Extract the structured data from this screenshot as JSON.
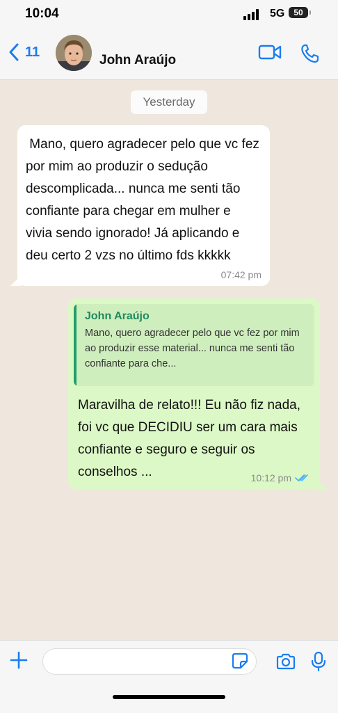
{
  "status_bar": {
    "time": "10:04",
    "network": "5G",
    "battery": "50"
  },
  "header": {
    "back_count": "11",
    "contact_name": "John Araújo"
  },
  "chat": {
    "date_separator": "Yesterday",
    "incoming": {
      "text": " Mano, quero agradecer pelo que vc fez por mim ao produzir o sedução descomplicada... nunca me senti tão confiante para chegar em mulher e vivia sendo ignorado! Já aplicando e deu certo 2 vzs no último fds kkkkk",
      "time": "07:42 pm"
    },
    "outgoing": {
      "quote_name": "John Araújo",
      "quote_text": "Mano, quero agradecer pelo que vc fez por mim ao produzir esse material... nunca me senti tão confiante para che...",
      "text": "Maravilha de relato!!! Eu não fiz nada, foi vc que DECIDIU ser um cara mais confiante e seguro e seguir os conselhos ...",
      "time": "10:12 pm",
      "status_icon": "double-check-read-icon"
    }
  },
  "input_bar": {
    "placeholder": ""
  },
  "colors": {
    "accent": "#1a7df0",
    "outgoing_bubble": "#dcf8c6",
    "quote_name": "#1f8a5f",
    "read_ticks": "#4fb3f5"
  }
}
